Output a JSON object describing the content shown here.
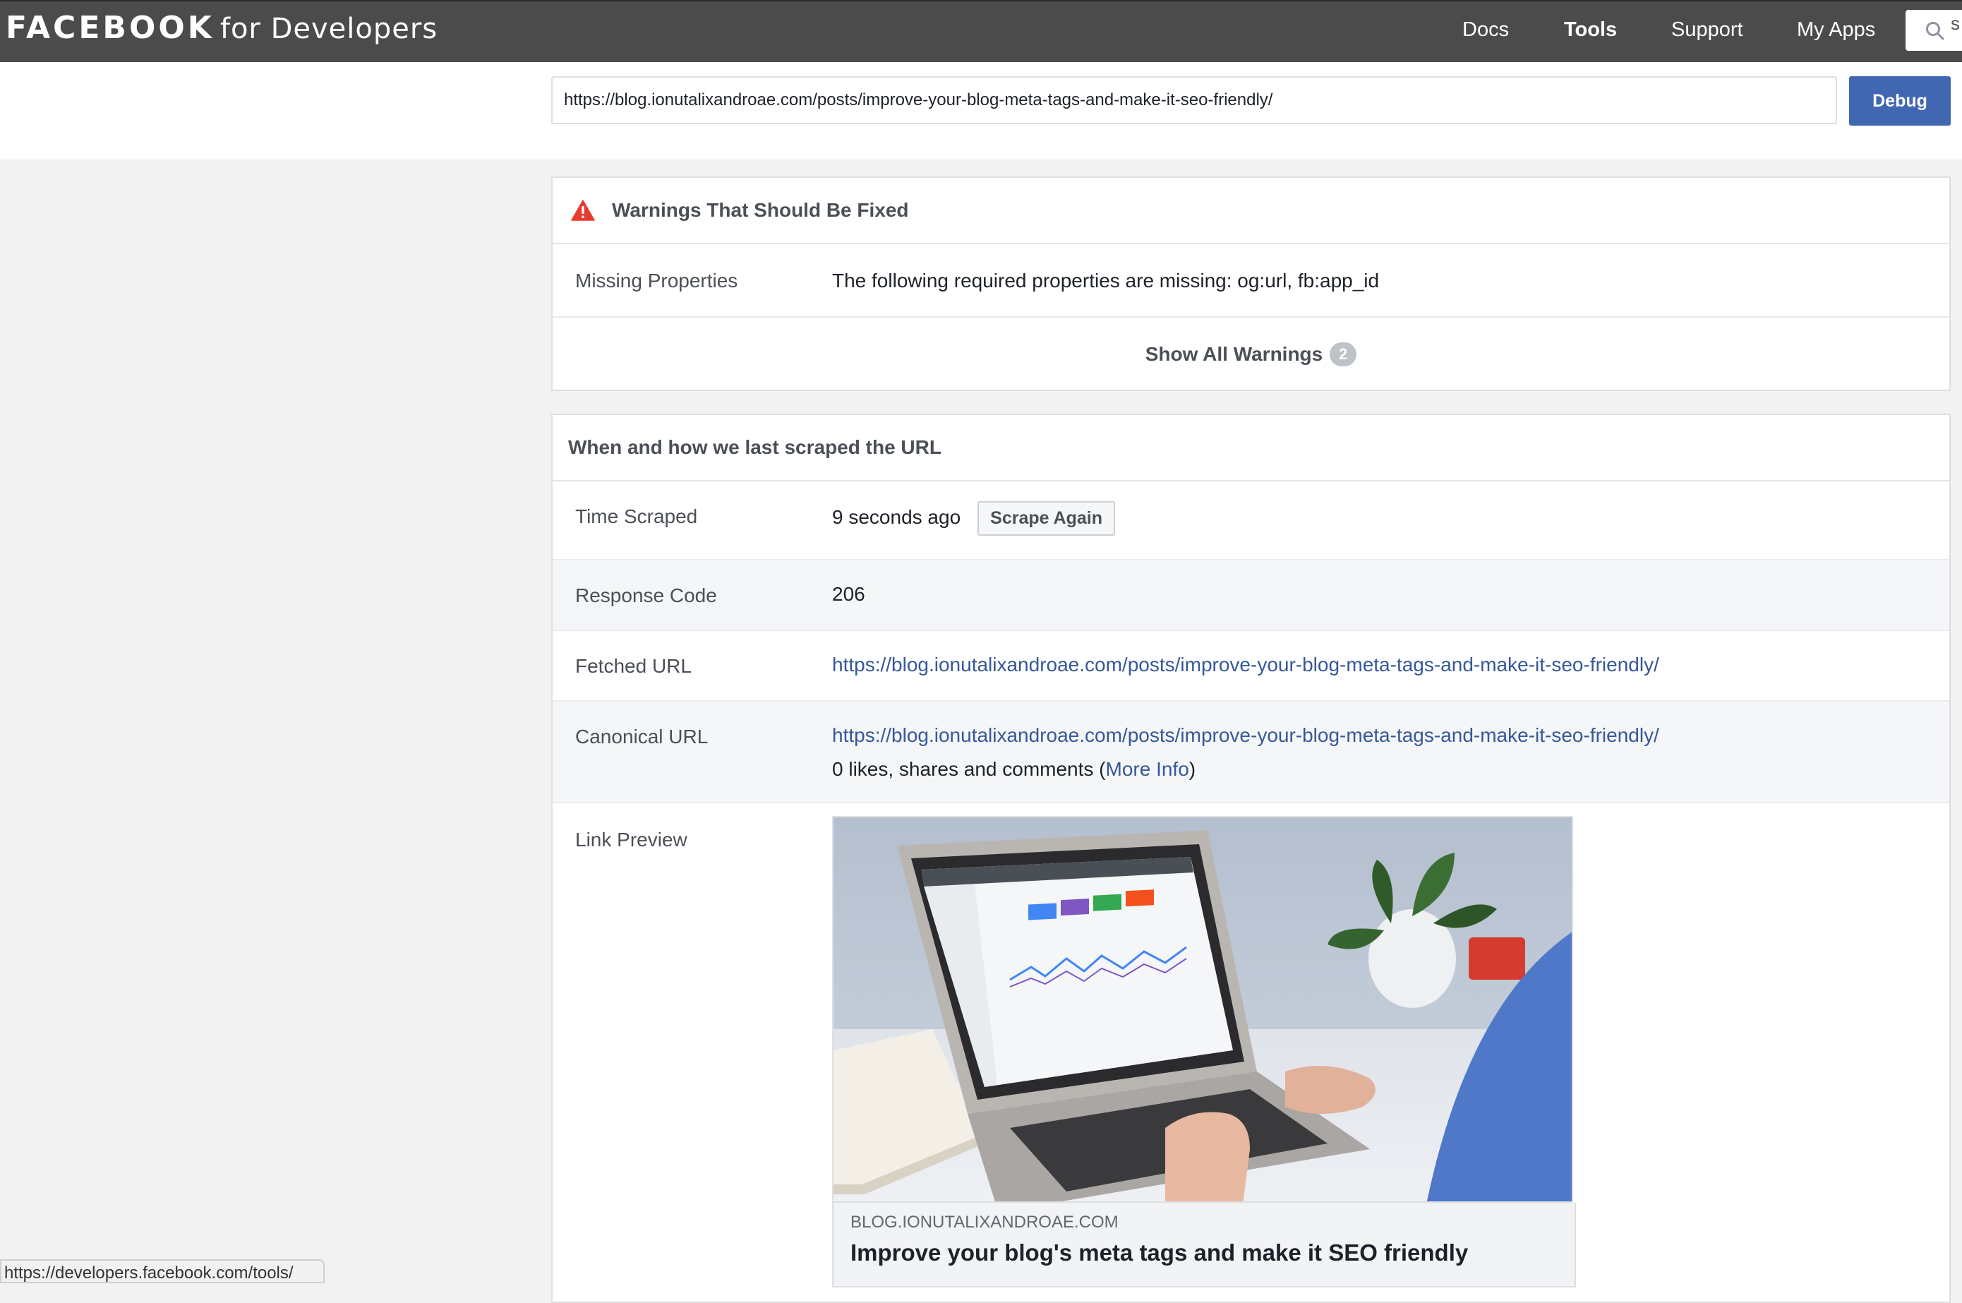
{
  "header": {
    "logo_main": "FACEBOOK",
    "logo_sub": "for Developers",
    "nav": [
      {
        "label": "Docs",
        "active": false
      },
      {
        "label": "Tools",
        "active": true
      },
      {
        "label": "Support",
        "active": false
      },
      {
        "label": "My Apps",
        "active": false
      }
    ],
    "search_peek": "s"
  },
  "debugger": {
    "url_value": "https://blog.ionutalixandroae.com/posts/improve-your-blog-meta-tags-and-make-it-seo-friendly/",
    "debug_label": "Debug"
  },
  "warnings": {
    "title": "Warnings That Should Be Fixed",
    "missing_label": "Missing Properties",
    "missing_text": "The following required properties are missing: og:url, fb:app_id",
    "show_all_label": "Show All Warnings",
    "count": "2"
  },
  "scrape": {
    "title": "When and how we last scraped the URL",
    "time_label": "Time Scraped",
    "time_value": "9 seconds ago",
    "scrape_again_label": "Scrape Again",
    "response_label": "Response Code",
    "response_value": "206",
    "fetched_label": "Fetched URL",
    "fetched_value": "https://blog.ionutalixandroae.com/posts/improve-your-blog-meta-tags-and-make-it-seo-friendly/",
    "canonical_label": "Canonical URL",
    "canonical_value": "https://blog.ionutalixandroae.com/posts/improve-your-blog-meta-tags-and-make-it-seo-friendly/",
    "engagement_prefix": "0 likes, shares and comments (",
    "more_info_label": "More Info",
    "engagement_suffix": ")",
    "preview_label": "Link Preview"
  },
  "preview": {
    "domain": "BLOG.IONUTALIXANDROAE.COM",
    "title": "Improve your blog's meta tags and make it SEO friendly",
    "image": "photo of hands typing on a laptop showing an analytics dashboard, with a potted plant in the background"
  },
  "statusbar": {
    "url": "https://developers.facebook.com/tools/"
  }
}
